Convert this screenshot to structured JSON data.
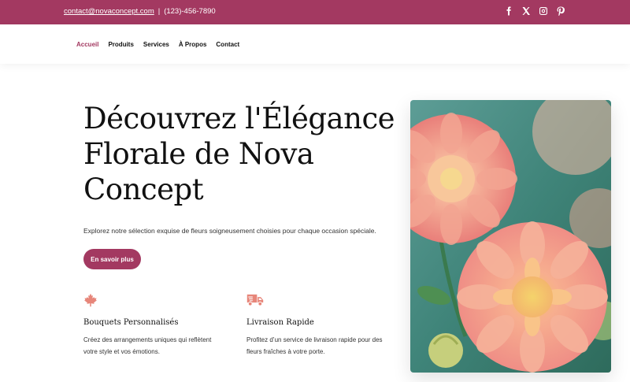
{
  "topbar": {
    "email": "contact@novaconcept.com",
    "separator": "|",
    "phone": "(123)-456-7890",
    "social_icons": [
      "facebook-icon",
      "x-icon",
      "instagram-icon",
      "pinterest-icon"
    ]
  },
  "nav": {
    "items": [
      "Accueil",
      "Produits",
      "Services",
      "À Propos",
      "Contact"
    ],
    "active": "Accueil"
  },
  "hero": {
    "title": "Découvrez l'Élégance Florale de Nova Concept",
    "lead": "Explorez notre sélection exquise de fleurs soigneusement choisies pour chaque occasion spéciale.",
    "cta_label": "En savoir plus"
  },
  "features": [
    {
      "icon": "maple-leaf-icon",
      "title": "Bouquets Personnalisés",
      "text": "Créez des arrangements uniques qui reflètent votre style et vos émotions."
    },
    {
      "icon": "delivery-truck-icon",
      "title": "Livraison Rapide",
      "text": "Profitez d’un service de livraison rapide pour des fleurs fraîches à votre porte."
    }
  ],
  "colors": {
    "brand": "#a33961",
    "icon_accent": "#e7867a"
  }
}
